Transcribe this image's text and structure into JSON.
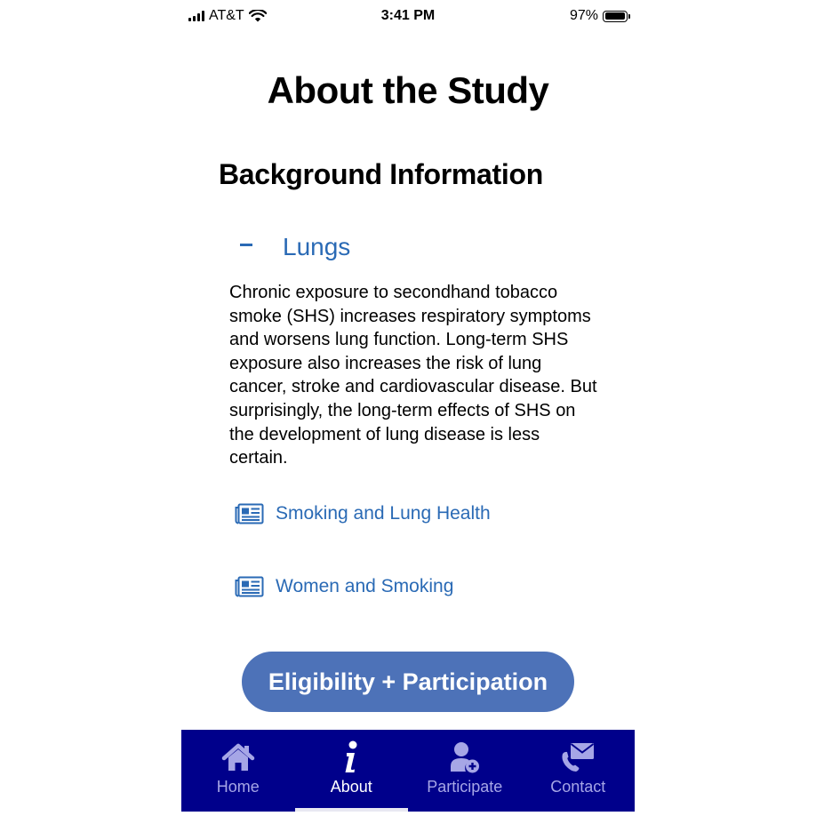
{
  "status_bar": {
    "carrier": "AT&T",
    "time": "3:41 PM",
    "battery_percent": "97%",
    "battery_level": 0.97
  },
  "page": {
    "title": "About the Study",
    "section_title": "Background Information"
  },
  "accordion": {
    "label": "Lungs",
    "expanded": true,
    "icon": "minus-icon",
    "body": "Chronic exposure to secondhand tobacco smoke (SHS) increases respiratory symptoms and worsens lung function. Long-term SHS exposure also increases the risk of lung cancer, stroke and cardiovascular disease. But surprisingly, the long-term effects of SHS on the development of lung disease is less certain."
  },
  "links": [
    {
      "label": "Smoking and Lung Health",
      "icon": "newspaper-icon"
    },
    {
      "label": "Women and Smoking",
      "icon": "newspaper-icon"
    }
  ],
  "cta": {
    "label": "Eligibility + Participation"
  },
  "tab_bar": {
    "tabs": [
      {
        "label": "Home",
        "icon": "home-icon",
        "active": false
      },
      {
        "label": "About",
        "icon": "info-icon",
        "active": true
      },
      {
        "label": "Participate",
        "icon": "add-user-icon",
        "active": false
      },
      {
        "label": "Contact",
        "icon": "contact-mail-icon",
        "active": false
      }
    ]
  },
  "colors": {
    "link_blue": "#2a6ab5",
    "button_blue": "#4d72b8",
    "tab_bar_bg": "#00008b",
    "tab_inactive": "#a6a6e6",
    "tab_active": "#ffffff"
  }
}
